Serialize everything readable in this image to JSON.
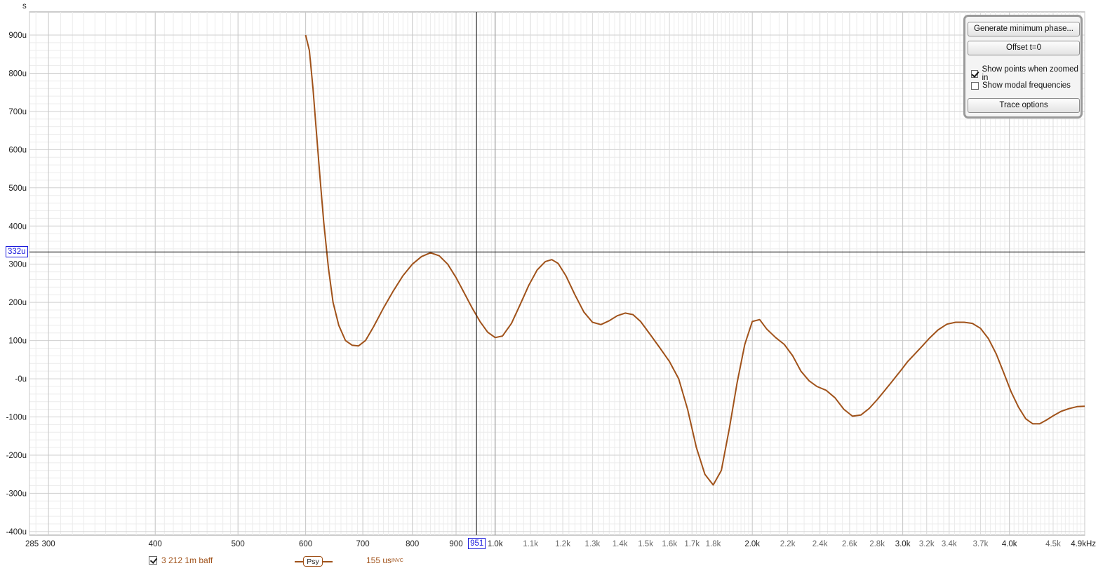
{
  "chart_data": {
    "type": "line",
    "ylabel": "s",
    "x_scale": "log",
    "xlim": [
      285,
      4900
    ],
    "ylim": [
      -470,
      900
    ],
    "y_ticks": [
      900,
      800,
      700,
      600,
      500,
      400,
      300,
      200,
      100,
      0,
      -100,
      -200,
      -300,
      -400
    ],
    "y_tick_labels": [
      "900u",
      "800u",
      "700u",
      "600u",
      "500u",
      "400u",
      "300u",
      "200u",
      "100u",
      "-0u",
      "-100u",
      "-200u",
      "-300u",
      "-400u"
    ],
    "x_ticks": [
      {
        "v": 285,
        "label": "285",
        "major": true
      },
      {
        "v": 300,
        "label": "300",
        "major": true
      },
      {
        "v": 400,
        "label": "400",
        "major": true
      },
      {
        "v": 500,
        "label": "500",
        "major": true
      },
      {
        "v": 600,
        "label": "600",
        "major": true
      },
      {
        "v": 700,
        "label": "700",
        "major": true
      },
      {
        "v": 800,
        "label": "800",
        "major": true
      },
      {
        "v": 900,
        "label": "900",
        "major": true
      },
      {
        "v": 1000,
        "label": "1.0k",
        "major": true
      },
      {
        "v": 1100,
        "label": "1.1k",
        "major": false
      },
      {
        "v": 1200,
        "label": "1.2k",
        "major": false
      },
      {
        "v": 1300,
        "label": "1.3k",
        "major": false
      },
      {
        "v": 1400,
        "label": "1.4k",
        "major": false
      },
      {
        "v": 1500,
        "label": "1.5k",
        "major": false
      },
      {
        "v": 1600,
        "label": "1.6k",
        "major": false
      },
      {
        "v": 1700,
        "label": "1.7k",
        "major": false
      },
      {
        "v": 1800,
        "label": "1.8k",
        "major": false
      },
      {
        "v": 2000,
        "label": "2.0k",
        "major": true
      },
      {
        "v": 2200,
        "label": "2.2k",
        "major": false
      },
      {
        "v": 2400,
        "label": "2.4k",
        "major": false
      },
      {
        "v": 2600,
        "label": "2.6k",
        "major": false
      },
      {
        "v": 2800,
        "label": "2.8k",
        "major": false
      },
      {
        "v": 3000,
        "label": "3.0k",
        "major": true
      },
      {
        "v": 3200,
        "label": "3.2k",
        "major": false
      },
      {
        "v": 3400,
        "label": "3.4k",
        "major": false
      },
      {
        "v": 3700,
        "label": "3.7k",
        "major": false
      },
      {
        "v": 4000,
        "label": "4.0k",
        "major": true
      },
      {
        "v": 4500,
        "label": "4.5k",
        "major": false
      },
      {
        "v": 4900,
        "label": "4.9kHz",
        "major": true
      }
    ],
    "grid": true,
    "series": [
      {
        "color": "#a0521a",
        "points": [
          [
            600,
            900
          ],
          [
            606,
            860
          ],
          [
            612,
            760
          ],
          [
            618,
            640
          ],
          [
            624,
            520
          ],
          [
            630,
            410
          ],
          [
            638,
            290
          ],
          [
            646,
            200
          ],
          [
            656,
            140
          ],
          [
            668,
            100
          ],
          [
            680,
            88
          ],
          [
            692,
            86
          ],
          [
            705,
            100
          ],
          [
            720,
            135
          ],
          [
            740,
            185
          ],
          [
            760,
            230
          ],
          [
            780,
            270
          ],
          [
            800,
            300
          ],
          [
            820,
            320
          ],
          [
            840,
            330
          ],
          [
            860,
            322
          ],
          [
            880,
            300
          ],
          [
            900,
            265
          ],
          [
            920,
            225
          ],
          [
            940,
            185
          ],
          [
            960,
            150
          ],
          [
            980,
            122
          ],
          [
            1000,
            108
          ],
          [
            1020,
            112
          ],
          [
            1045,
            145
          ],
          [
            1070,
            195
          ],
          [
            1095,
            245
          ],
          [
            1120,
            285
          ],
          [
            1145,
            307
          ],
          [
            1165,
            312
          ],
          [
            1185,
            302
          ],
          [
            1210,
            270
          ],
          [
            1240,
            220
          ],
          [
            1270,
            175
          ],
          [
            1300,
            148
          ],
          [
            1330,
            142
          ],
          [
            1360,
            152
          ],
          [
            1390,
            165
          ],
          [
            1420,
            172
          ],
          [
            1450,
            168
          ],
          [
            1480,
            150
          ],
          [
            1520,
            115
          ],
          [
            1560,
            80
          ],
          [
            1600,
            45
          ],
          [
            1640,
            0
          ],
          [
            1680,
            -80
          ],
          [
            1720,
            -180
          ],
          [
            1760,
            -250
          ],
          [
            1800,
            -278
          ],
          [
            1840,
            -240
          ],
          [
            1880,
            -130
          ],
          [
            1920,
            -10
          ],
          [
            1960,
            90
          ],
          [
            2000,
            150
          ],
          [
            2040,
            155
          ],
          [
            2080,
            130
          ],
          [
            2130,
            108
          ],
          [
            2180,
            90
          ],
          [
            2230,
            60
          ],
          [
            2280,
            20
          ],
          [
            2330,
            -5
          ],
          [
            2380,
            -20
          ],
          [
            2440,
            -30
          ],
          [
            2500,
            -50
          ],
          [
            2560,
            -80
          ],
          [
            2620,
            -98
          ],
          [
            2680,
            -95
          ],
          [
            2740,
            -78
          ],
          [
            2800,
            -55
          ],
          [
            2860,
            -30
          ],
          [
            2920,
            -5
          ],
          [
            2980,
            20
          ],
          [
            3040,
            45
          ],
          [
            3100,
            65
          ],
          [
            3160,
            85
          ],
          [
            3220,
            105
          ],
          [
            3300,
            128
          ],
          [
            3380,
            143
          ],
          [
            3460,
            148
          ],
          [
            3540,
            148
          ],
          [
            3620,
            145
          ],
          [
            3700,
            132
          ],
          [
            3780,
            105
          ],
          [
            3860,
            65
          ],
          [
            3940,
            15
          ],
          [
            4020,
            -35
          ],
          [
            4100,
            -75
          ],
          [
            4180,
            -105
          ],
          [
            4260,
            -118
          ],
          [
            4340,
            -118
          ],
          [
            4420,
            -108
          ],
          [
            4500,
            -97
          ],
          [
            4600,
            -85
          ],
          [
            4700,
            -78
          ],
          [
            4800,
            -73
          ],
          [
            4900,
            -72
          ]
        ]
      }
    ],
    "cursor": {
      "x": 951,
      "x_label": "951",
      "y": 332,
      "y_label": "332u"
    },
    "ref_line_x": 1000
  },
  "controls": {
    "generate_min_phase": "Generate minimum phase...",
    "offset_t0": "Offset t=0",
    "show_points": "Show points when zoomed in",
    "show_points_checked": true,
    "show_modal": "Show modal frequencies",
    "show_modal_checked": false,
    "trace_options": "Trace options"
  },
  "legend": {
    "trace_name": "3 212 1m baff",
    "smoothing": "Psy",
    "value": "155 us",
    "value_suffix": "INVC",
    "color": "#a0521a"
  }
}
